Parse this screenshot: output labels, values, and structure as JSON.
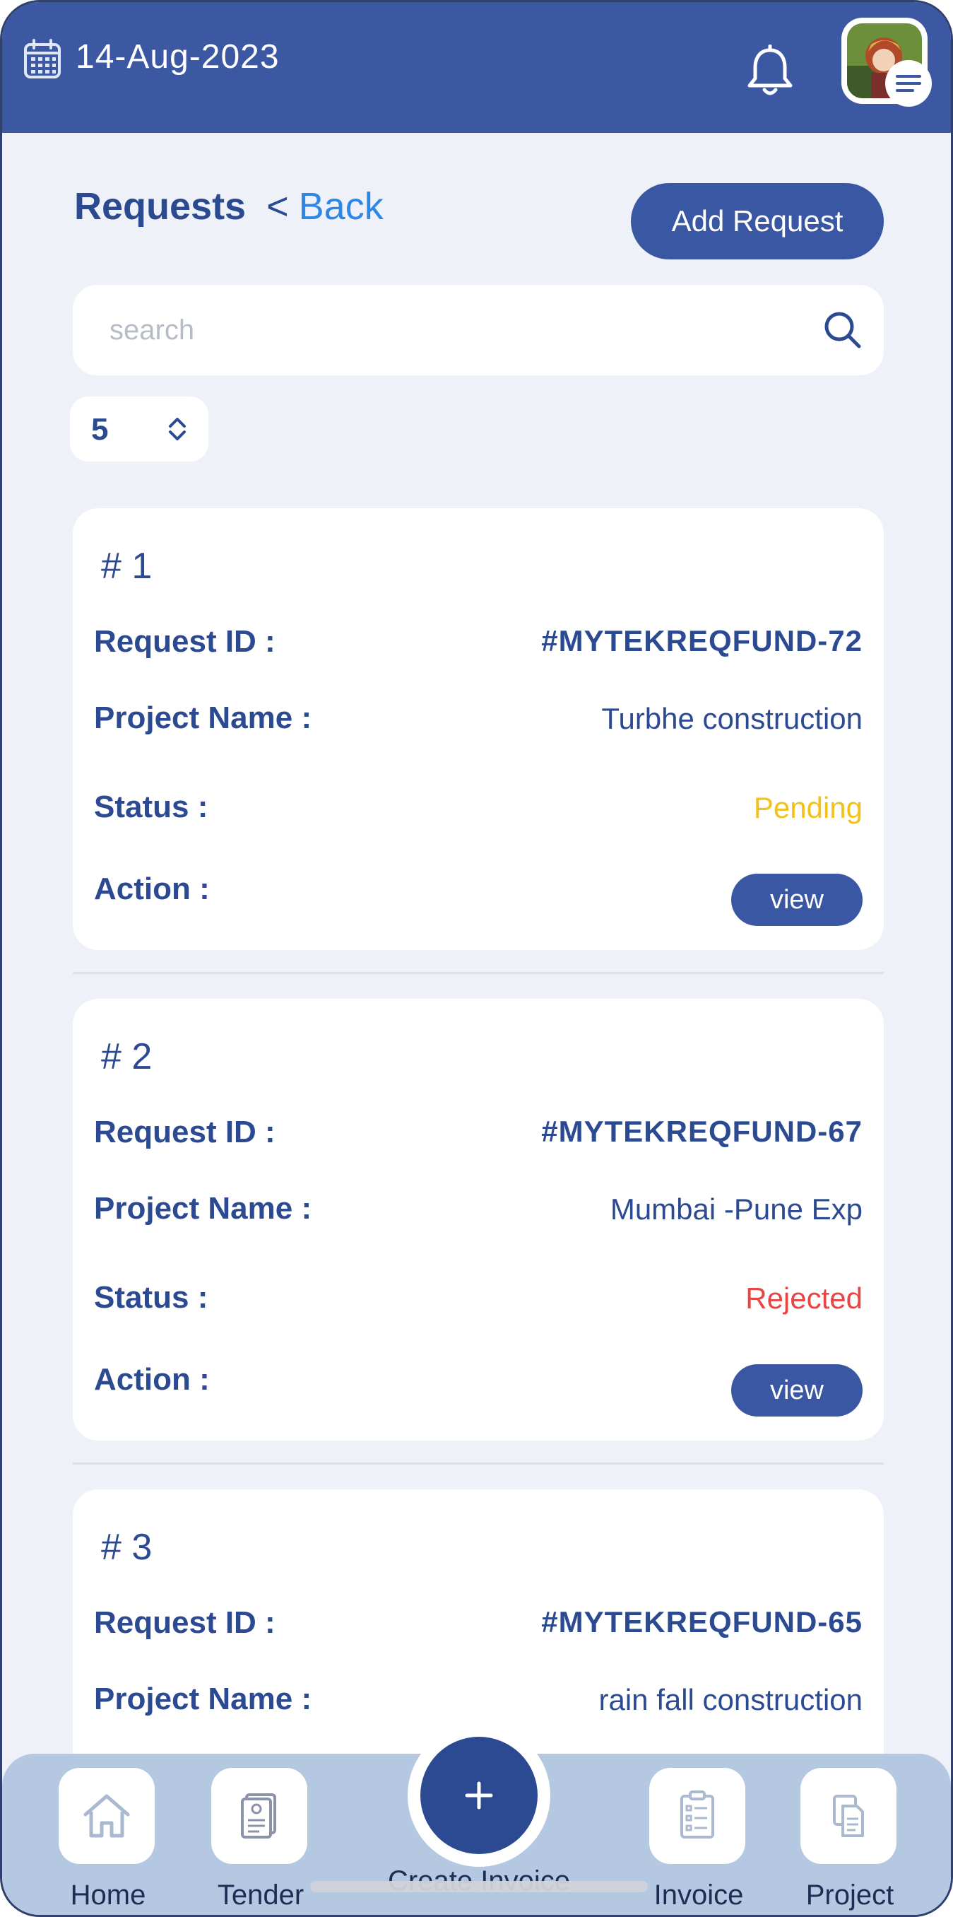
{
  "header": {
    "date": "14-Aug-2023",
    "icons": [
      "calendar-icon",
      "bell-icon",
      "avatar",
      "menu-icon"
    ],
    "color": "#3d58a3"
  },
  "page": {
    "title": "Requests",
    "back_prefix": "<",
    "back_label": "Back",
    "add_button": "Add Request"
  },
  "search": {
    "placeholder": "search",
    "value": ""
  },
  "page_size": {
    "value": "5"
  },
  "labels": {
    "request_id": "Request ID :",
    "project_name": "Project Name :",
    "status": "Status :",
    "action": "Action :",
    "view": "view"
  },
  "requests": [
    {
      "number": "# 1",
      "request_id": "#MYTEKREQFUND-72",
      "project_name": "Turbhe construction",
      "status": "Pending",
      "status_color": "#f2c21b"
    },
    {
      "number": "# 2",
      "request_id": "#MYTEKREQFUND-67",
      "project_name": "Mumbai -Pune Exp",
      "status": "Rejected",
      "status_color": "#e84545"
    },
    {
      "number": "# 3",
      "request_id": "#MYTEKREQFUND-65",
      "project_name": "rain fall construction"
    }
  ],
  "bottom_nav": {
    "items": [
      {
        "label": "Home",
        "icon": "home-icon"
      },
      {
        "label": "Tender",
        "icon": "tender-icon"
      },
      {
        "label": "Create Invoice",
        "icon": "plus-icon"
      },
      {
        "label": "Invoice",
        "icon": "invoice-icon"
      },
      {
        "label": "Project",
        "icon": "project-icon"
      }
    ]
  }
}
